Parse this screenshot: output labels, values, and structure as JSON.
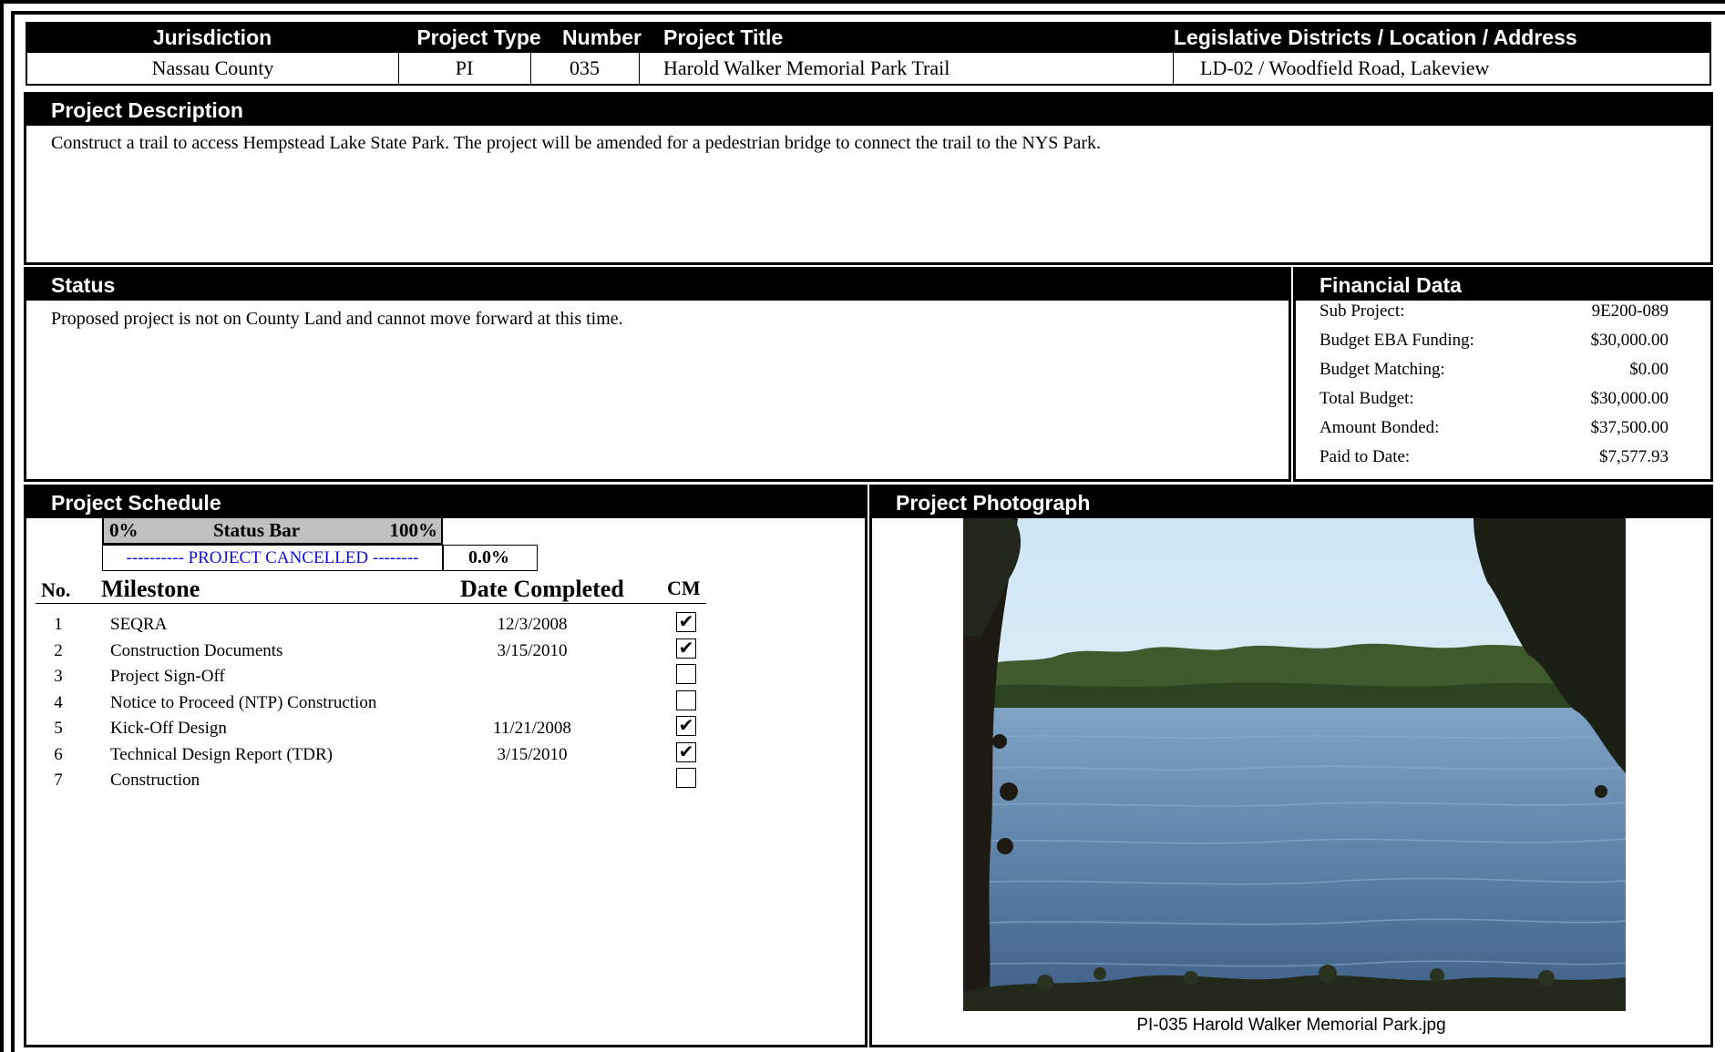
{
  "header": {
    "col_jurisdiction": "Jurisdiction",
    "col_type": "Project Type",
    "col_number": "Number",
    "col_title": "Project Title",
    "col_location": "Legislative Districts / Location / Address",
    "jurisdiction": "Nassau County",
    "type": "PI",
    "number": "035",
    "title": "Harold Walker Memorial Park Trail",
    "location": "LD-02 / Woodfield Road, Lakeview"
  },
  "description": {
    "heading": "Project Description",
    "text": "Construct a trail to access Hempstead Lake State Park. The project will be amended for a pedestrian bridge to connect the trail to the NYS Park."
  },
  "status": {
    "heading": "Status",
    "text": "Proposed project is not on County Land and cannot move forward at this time."
  },
  "financial": {
    "heading": "Financial Data",
    "rows": [
      {
        "label": "Sub Project:",
        "value": "9E200-089"
      },
      {
        "label": "Budget EBA Funding:",
        "value": "$30,000.00"
      },
      {
        "label": "Budget Matching:",
        "value": "$0.00"
      },
      {
        "label": "Total Budget:",
        "value": "$30,000.00"
      },
      {
        "label": "Amount Bonded:",
        "value": "$37,500.00"
      },
      {
        "label": "Paid to Date:",
        "value": "$7,577.93"
      }
    ]
  },
  "schedule": {
    "heading": "Project Schedule",
    "bar_start": "0%",
    "bar_label": "Status Bar",
    "bar_end": "100%",
    "status_text": "---------- PROJECT CANCELLED --------",
    "percent": "0.0%",
    "progress_fraction": 0.0,
    "col_no": "No.",
    "col_milestone": "Milestone",
    "col_date": "Date Completed",
    "col_cm": "CM",
    "milestones": [
      {
        "no": "1",
        "name": "SEQRA",
        "date": "12/3/2008",
        "cm": "✔"
      },
      {
        "no": "2",
        "name": "Construction Documents",
        "date": "3/15/2010",
        "cm": "✔"
      },
      {
        "no": "3",
        "name": "Project Sign-Off",
        "date": "",
        "cm": ""
      },
      {
        "no": "4",
        "name": "Notice to Proceed (NTP) Construction",
        "date": "",
        "cm": ""
      },
      {
        "no": "5",
        "name": "Kick-Off Design",
        "date": "11/21/2008",
        "cm": "✔"
      },
      {
        "no": "6",
        "name": "Technical Design Report (TDR)",
        "date": "3/15/2010",
        "cm": "✔"
      },
      {
        "no": "7",
        "name": "Construction",
        "date": "",
        "cm": ""
      }
    ]
  },
  "photo": {
    "heading": "Project Photograph",
    "caption": "PI-035 Harold Walker Memorial Park.jpg"
  }
}
